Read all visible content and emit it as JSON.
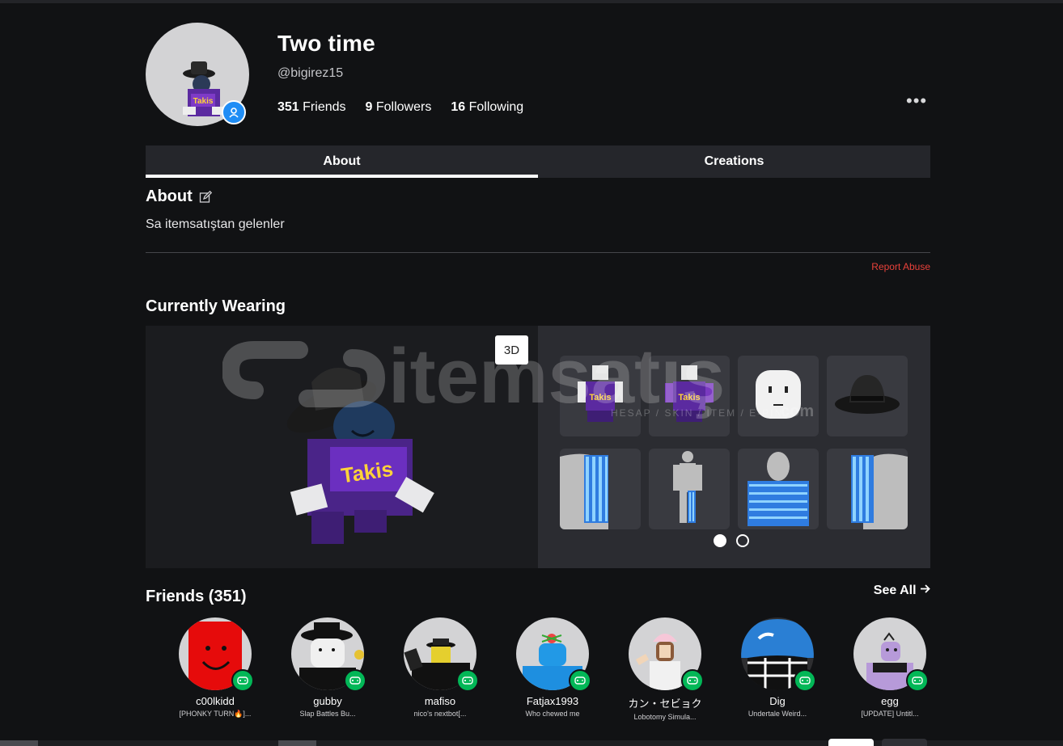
{
  "profile": {
    "display_name": "Two time",
    "username": "@bigirez15",
    "stats": [
      {
        "count": "351",
        "label": "Friends"
      },
      {
        "count": "9",
        "label": "Followers"
      },
      {
        "count": "16",
        "label": "Following"
      }
    ],
    "more_label": "•••"
  },
  "tabs": [
    {
      "label": "About",
      "active": true
    },
    {
      "label": "Creations",
      "active": false
    }
  ],
  "about": {
    "heading": "About",
    "text": "Sa itemsatıştan gelenler",
    "report_label": "Report Abuse"
  },
  "wearing": {
    "heading": "Currently Wearing",
    "view_toggle": "3D",
    "watermark_text": "itemsatış",
    "watermark_sub": "HESAP / SKIN / ITEM / E-PIN",
    "watermark_tld": "com",
    "page": 1,
    "page_count": 2,
    "items": [
      {
        "icon": "takis-shirt-icon"
      },
      {
        "icon": "takis-pants-icon"
      },
      {
        "icon": "face-icon"
      },
      {
        "icon": "fedora-hat-icon"
      },
      {
        "icon": "checker-left-arm-icon"
      },
      {
        "icon": "checker-leg-icon"
      },
      {
        "icon": "checker-torso-icon"
      },
      {
        "icon": "checker-right-arm-icon"
      }
    ]
  },
  "friends": {
    "heading": "Friends (351)",
    "see_all_label": "See All",
    "list": [
      {
        "name": "c00lkidd",
        "game": "[PHONKY TURN🔥]..."
      },
      {
        "name": "gubby",
        "game": "Slap Battles Bu..."
      },
      {
        "name": "mafiso",
        "game": "nico's nextbot[..."
      },
      {
        "name": "Fatjax1993",
        "game": "Who chewed me"
      },
      {
        "name": "カン・セビョク",
        "game": "Lobotomy Simula..."
      },
      {
        "name": "Dig",
        "game": "Undertale Weird..."
      },
      {
        "name": "egg",
        "game": "[UPDATE] Untitl..."
      }
    ]
  },
  "colors": {
    "background": "#111214",
    "tab_bar": "#25262b",
    "report_red": "#e8413a",
    "online_green": "#02b757",
    "badge_blue": "#1f8df5"
  }
}
